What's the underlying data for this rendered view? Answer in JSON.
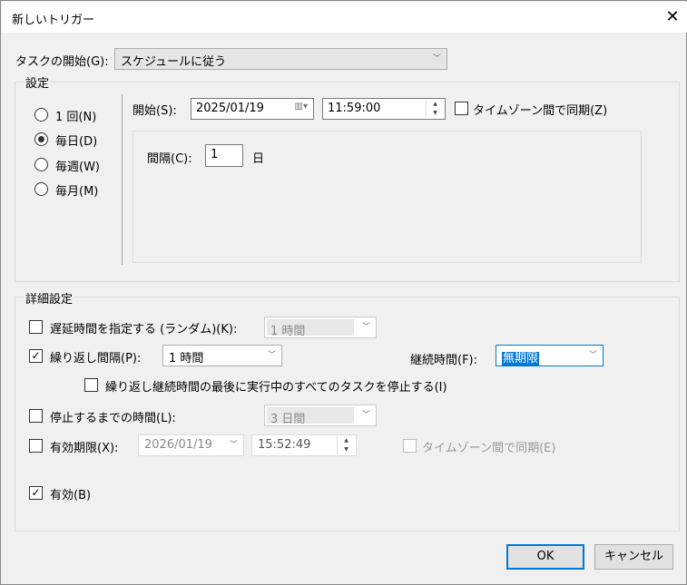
{
  "title": "新しいトリガー",
  "task_start": {
    "label": "タスクの開始(G):",
    "value": "スケジュールに従う"
  },
  "settings": {
    "legend": "設定",
    "radios": [
      {
        "label": "1 回(N)",
        "checked": false
      },
      {
        "label": "毎日(D)",
        "checked": true
      },
      {
        "label": "毎週(W)",
        "checked": false
      },
      {
        "label": "毎月(M)",
        "checked": false
      }
    ],
    "start_label": "開始(S):",
    "start_date": "2025/01/19",
    "start_time": "11:59:00",
    "sync_tz_label": "タイムゾーン間で同期(Z)",
    "interval_label": "間隔(C):",
    "interval_value": "1",
    "interval_unit": "日"
  },
  "advanced": {
    "legend": "詳細設定",
    "delay": {
      "label": "遅延時間を指定する (ランダム)(K):",
      "value": "1 時間",
      "checked": false
    },
    "repeat": {
      "label": "繰り返し間隔(P):",
      "value": "1 時間",
      "checked": true
    },
    "duration": {
      "label": "継続時間(F):",
      "value": "無期限"
    },
    "stop_at_end": {
      "label": "繰り返し継続時間の最後に実行中のすべてのタスクを停止する(I)",
      "checked": false
    },
    "stop_after": {
      "label": "停止するまでの時間(L):",
      "value": "3 日間",
      "checked": false
    },
    "expire": {
      "label": "有効期限(X):",
      "date": "2026/01/19",
      "time": "15:52:49",
      "checked": false
    },
    "expire_sync_tz": {
      "label": "タイムゾーン間で同期(E)",
      "checked": false
    },
    "enabled": {
      "label": "有効(B)",
      "checked": true
    }
  },
  "buttons": {
    "ok": "OK",
    "cancel": "キャンセル"
  }
}
